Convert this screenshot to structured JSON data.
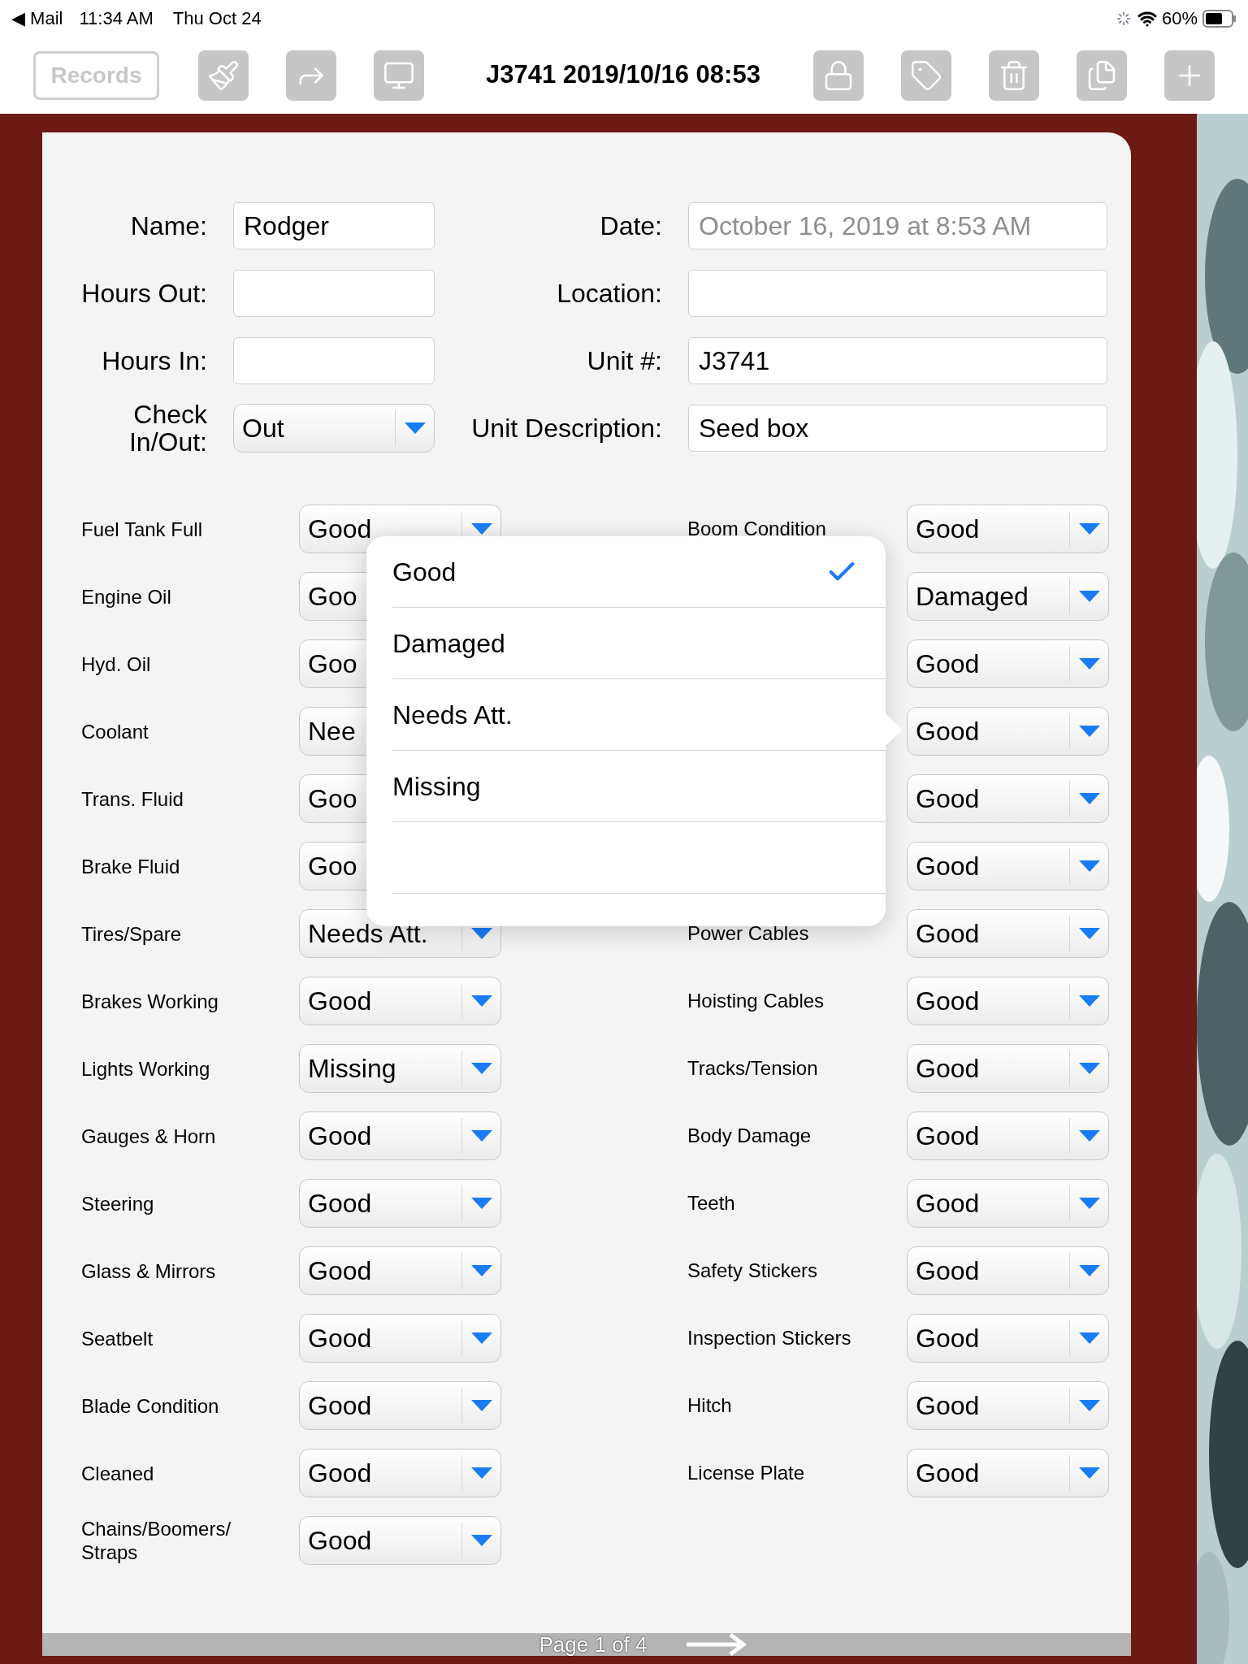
{
  "status_bar": {
    "back": "◀ Mail",
    "time": "11:34 AM",
    "date": "Thu Oct 24",
    "battery": "60%"
  },
  "toolbar": {
    "records": "Records",
    "title": "J3741 2019/10/16 08:53"
  },
  "form": {
    "left": [
      {
        "label": "Name:",
        "value": "Rodger"
      },
      {
        "label": "Hours Out:"
      },
      {
        "label": "Hours In:"
      },
      {
        "label": "Check In/Out:",
        "value": "Out",
        "kind": "select"
      }
    ],
    "right": [
      {
        "label": "Date:",
        "placeholder": "October 16, 2019 at 8:53 AM"
      },
      {
        "label": "Location:"
      },
      {
        "label": "Unit #:",
        "value": "J3741"
      },
      {
        "label": "Unit Description:",
        "value": "Seed box"
      }
    ]
  },
  "checklist_left": [
    {
      "label": "Fuel Tank Full",
      "value": "Good"
    },
    {
      "label": "Engine Oil",
      "value": "Goo",
      "covered": true
    },
    {
      "label": "Hyd. Oil",
      "value": "Goo",
      "covered": true
    },
    {
      "label": "Coolant",
      "value": "Nee",
      "covered": true
    },
    {
      "label": "Trans. Fluid",
      "value": "Goo",
      "covered": true
    },
    {
      "label": "Brake Fluid",
      "value": "Goo",
      "covered": true
    },
    {
      "label": "Tires/Spare",
      "value": "Needs Att."
    },
    {
      "label": "Brakes Working",
      "value": "Good"
    },
    {
      "label": "Lights Working",
      "value": "Missing"
    },
    {
      "label": "Gauges & Horn",
      "value": "Good"
    },
    {
      "label": "Steering",
      "value": "Good"
    },
    {
      "label": "Glass & Mirrors",
      "value": "Good"
    },
    {
      "label": "Seatbelt",
      "value": "Good"
    },
    {
      "label": "Blade Condition",
      "value": "Good"
    },
    {
      "label": "Cleaned",
      "value": "Good"
    },
    {
      "label": "Chains/Boomers/ Straps",
      "value": "Good"
    }
  ],
  "checklist_right": [
    {
      "label": "Boom Condition",
      "value": "Good"
    },
    {
      "value": "Damaged"
    },
    {
      "value": "Good"
    },
    {
      "value": "Good"
    },
    {
      "value": "Good"
    },
    {
      "value": "Good"
    },
    {
      "label": "Power Cables",
      "value": "Good"
    },
    {
      "label": "Hoisting Cables",
      "value": "Good"
    },
    {
      "label": "Tracks/Tension",
      "value": "Good"
    },
    {
      "label": "Body Damage",
      "value": "Good"
    },
    {
      "label": "Teeth",
      "value": "Good"
    },
    {
      "label": "Safety Stickers",
      "value": "Good"
    },
    {
      "label": "Inspection Stickers",
      "value": "Good"
    },
    {
      "label": "Hitch",
      "value": "Good"
    },
    {
      "label": "License Plate",
      "value": "Good"
    }
  ],
  "popover": {
    "items": [
      {
        "label": "Good",
        "selected": true
      },
      {
        "label": "Damaged",
        "selected": false
      },
      {
        "label": "Needs Att.",
        "selected": false
      },
      {
        "label": "Missing",
        "selected": false
      },
      {
        "selected": false
      }
    ]
  },
  "footer": {
    "page": "Page 1 of 4"
  }
}
